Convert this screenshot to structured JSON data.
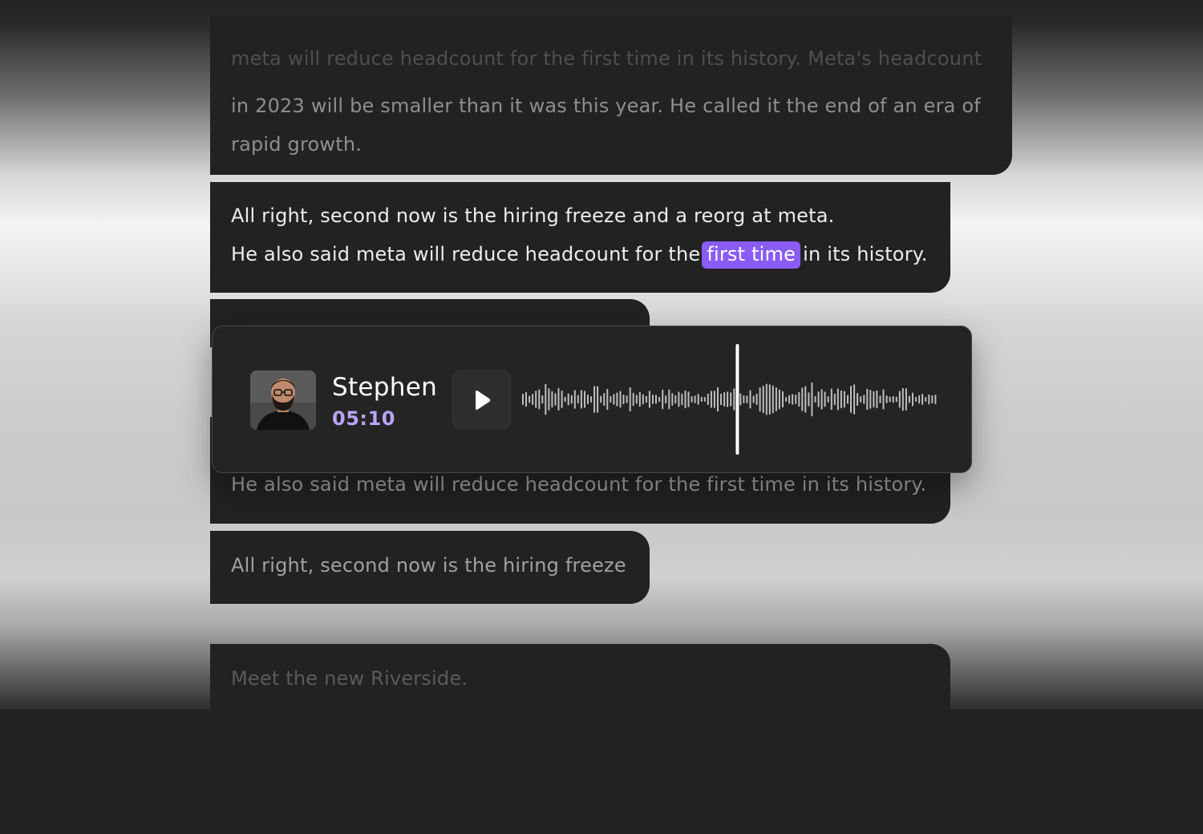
{
  "transcript": {
    "segment_1": {
      "line_1": "meta will reduce headcount for the first time in its history. Meta's headcount",
      "line_2": "in 2023 will be smaller than it was this year. He called it the end of an era of",
      "line_3": "rapid growth."
    },
    "segment_2": {
      "line_1": "All right, second now is the hiring freeze and a reorg at meta.",
      "line_2_before": "He also said meta will reduce headcount for the",
      "line_2_highlight": "first time",
      "line_2_after": "in its history."
    },
    "segment_4": {
      "line_1": "He also said meta will reduce headcount for the first time in its history."
    },
    "segment_5": {
      "line_1": "All right, second now is the hiring freeze"
    },
    "segment_6": {
      "line_1": "Meet the new Riverside."
    }
  },
  "player": {
    "speaker_name": "Stephen",
    "timestamp": "05:10",
    "play_icon": "play-icon",
    "playhead_position": 0.52
  },
  "colors": {
    "highlight": "#8a5cf6",
    "timestamp": "#b9a4f5",
    "bubble_background": "#222222"
  }
}
